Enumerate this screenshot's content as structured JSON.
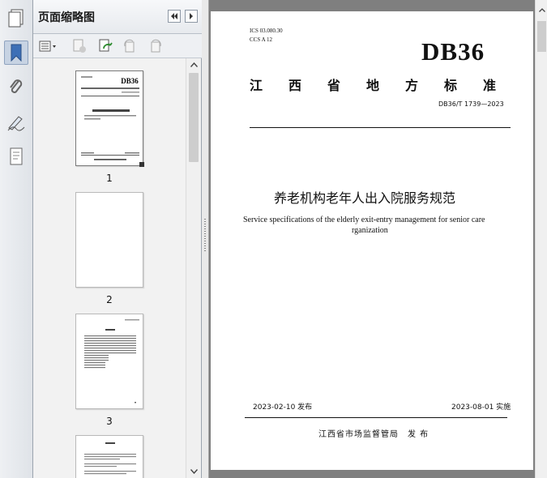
{
  "panel": {
    "title": "页面缩略图",
    "pages": [
      "1",
      "2",
      "3"
    ]
  },
  "cover": {
    "ics": "ICS 03.080.30",
    "ccs": "CCS A 12",
    "code": "DB36",
    "issuer_region": "江　西　省　地　方　标　准",
    "std_number": "DB36/T 1739—2023",
    "title_cn": "养老机构老年人出入院服务规范",
    "title_en_1": "Service specifications of the elderly exit-entry management for senior care",
    "title_en_2": "rganization",
    "publish_date": "2023-02-10 发布",
    "effective_date": "2023-08-01 实施",
    "publisher": "江西省市场监督管局　发 布"
  },
  "colors": {
    "accent": "#c7d3e3",
    "page_bg": "#ffffff",
    "doc_bg": "#7f7f7f"
  }
}
